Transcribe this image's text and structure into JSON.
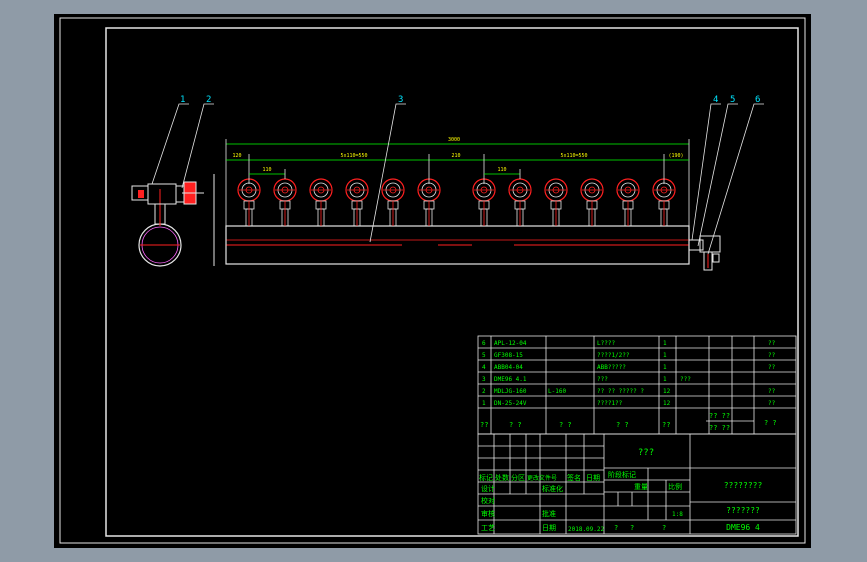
{
  "colors": {
    "background": "#8f9ba7",
    "paper": "#000000",
    "line_white": "#e6e6e6",
    "line_cyan": "#00e5ff",
    "line_green": "#00ff00",
    "line_red": "#ff2020",
    "line_yellow": "#ffff00"
  },
  "balloons": [
    "1",
    "2",
    "3",
    "4",
    "5",
    "6"
  ],
  "dimensions": {
    "overall": "3000",
    "left_end": "120",
    "left_pitch": "110",
    "left_group": "5x110=550",
    "middle_gap": "210",
    "right_pitch": "110",
    "right_group": "5x110=550",
    "right_end": "(190)"
  },
  "bom": {
    "rows": [
      {
        "no": "6",
        "code": "APL-12-04",
        "spec": "",
        "name": "L????",
        "qty": "1",
        "material": "",
        "note": "??"
      },
      {
        "no": "5",
        "code": "GF308-15",
        "spec": "",
        "name": "????1/2??",
        "qty": "1",
        "material": "",
        "note": "??"
      },
      {
        "no": "4",
        "code": "ABB04-04",
        "spec": "",
        "name": "ABB?????",
        "qty": "1",
        "material": "",
        "note": "??"
      },
      {
        "no": "3",
        "code": "DME96 4.1",
        "spec": "",
        "name": "???",
        "qty": "1",
        "material": "???",
        "note": ""
      },
      {
        "no": "2",
        "code": "MDLJG-160",
        "spec": "L-160",
        "name": "?? ?? ????? ?",
        "qty": "12",
        "material": "",
        "note": "??"
      },
      {
        "no": "1",
        "code": "DN-25-24V",
        "spec": "",
        "name": "????1??",
        "qty": "12",
        "material": "",
        "note": "??"
      }
    ],
    "header": {
      "no": "??",
      "code": "?  ?",
      "spec": "?  ?",
      "name": "?  ?",
      "qty": "??",
      "weight_top": "?? ??",
      "weight_bottom": "?? ??",
      "note": "?  ?"
    }
  },
  "title_block": {
    "company": "???",
    "drawing_name": "????????",
    "drawing_code": "???????",
    "drawing_no": "DME96 4",
    "scale": "1:8",
    "date": "2018.09.22",
    "sheet_a": "?",
    "sheet_b": "?",
    "sheet_c": "?",
    "rev_labels": [
      "标记",
      "处数",
      "分区",
      "更改文件号",
      "签名",
      "日期"
    ],
    "left_labels": [
      "设计",
      "校对",
      "审核",
      "工艺"
    ],
    "mid_labels": [
      "标准化",
      "批准",
      "日期"
    ],
    "stage_labels": [
      "阶段标记",
      "重量",
      "比例"
    ]
  }
}
